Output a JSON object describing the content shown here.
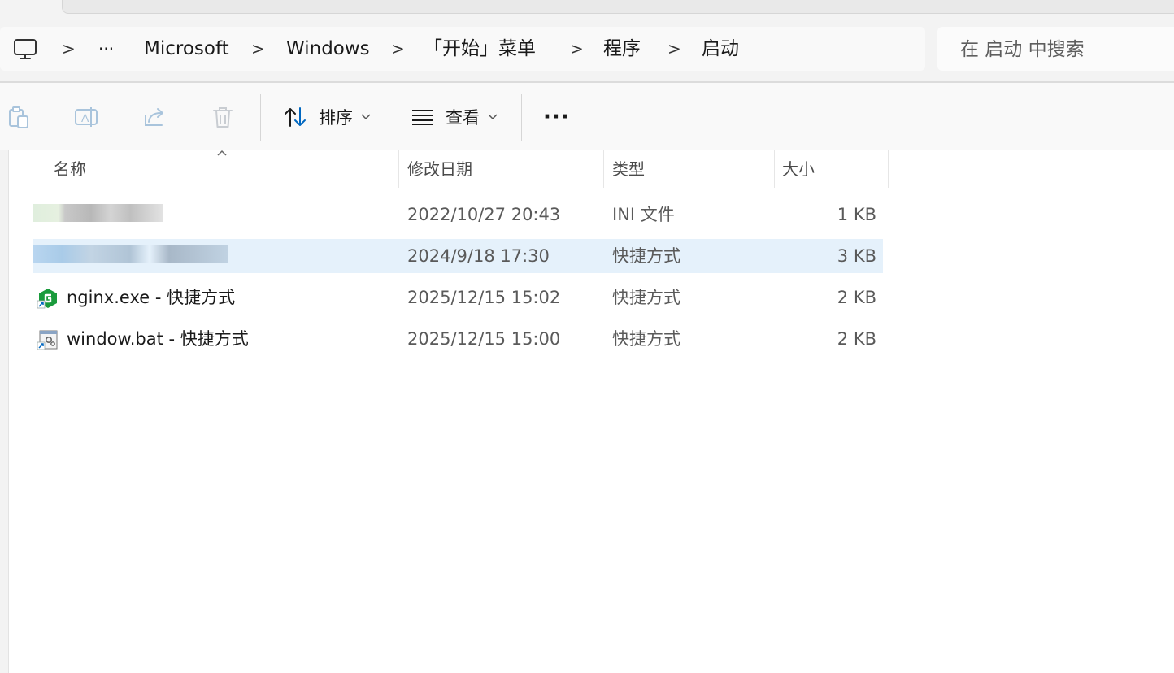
{
  "breadcrumb": {
    "overflow": "···",
    "items": [
      "Microsoft",
      "Windows",
      "「开始」菜单",
      "程序",
      "启动"
    ],
    "separator": ">"
  },
  "search": {
    "placeholder": "在 启动 中搜索"
  },
  "toolbar": {
    "icons": [
      "copy-icon",
      "rename-icon",
      "share-icon",
      "delete-icon"
    ],
    "sort_label": "排序",
    "view_label": "查看",
    "more_label": "···"
  },
  "columns": {
    "name": "名称",
    "date": "修改日期",
    "type": "类型",
    "size": "大小"
  },
  "files": [
    {
      "name": "",
      "date": "2022/10/27 20:43",
      "type": "INI 文件",
      "size": "1 KB",
      "obscured": true
    },
    {
      "name": "",
      "date": "2024/9/18 17:30",
      "type": "快捷方式",
      "size": "3 KB",
      "obscured": true,
      "selected": true
    },
    {
      "name": "nginx.exe - 快捷方式",
      "date": "2025/12/15 15:02",
      "type": "快捷方式",
      "size": "2 KB",
      "icon": "nginx-icon"
    },
    {
      "name": "window.bat - 快捷方式",
      "date": "2025/12/15 15:00",
      "type": "快捷方式",
      "size": "2 KB",
      "icon": "batch-file-icon"
    }
  ],
  "colors": {
    "selection": "#e5f1fb",
    "accent": "#0067c0",
    "nginx_green": "#1a9b3c"
  }
}
